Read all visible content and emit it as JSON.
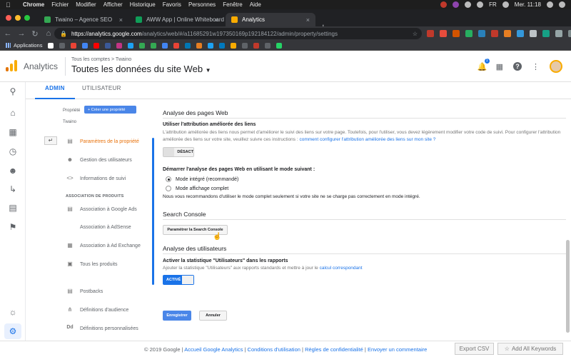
{
  "menubar": {
    "app": "Chrome",
    "items": [
      "Fichier",
      "Modifier",
      "Afficher",
      "Historique",
      "Favoris",
      "Personnes",
      "Fenêtre",
      "Aide"
    ],
    "clock": "Mer. 11:18",
    "lang": "FR"
  },
  "tabs": [
    {
      "title": "Twaino – Agence SEO",
      "icon_color": "#34a853"
    },
    {
      "title": "AWW App | Online Whiteboard",
      "icon_color": "#0f9d58"
    },
    {
      "title": "Analytics",
      "icon_color": "#f9ab00"
    }
  ],
  "toolbar": {
    "url_host": "https://analytics.google.com",
    "url_path": "/analytics/web/#/a11685291w197350169p192184122/admin/property/settings"
  },
  "bookmarks": {
    "apps_label": "Applications"
  },
  "header": {
    "product": "Analytics",
    "breadcrumb": "Tous les comptes > Twaino",
    "view_title": "Toutes les données du site Web",
    "notif_count": "1"
  },
  "admin_tabs": [
    "ADMIN",
    "UTILISATEUR"
  ],
  "property_menu": {
    "label": "Propriété",
    "create_btn": "+ Créer une propriété",
    "property_name": "Twaino",
    "items": [
      {
        "label": "Paramètres de la propriété",
        "icon": "settings-page-icon",
        "active": true
      },
      {
        "label": "Gestion des utilisateurs",
        "icon": "users-icon"
      },
      {
        "label": "Informations de suivi",
        "icon": "code-icon"
      }
    ],
    "section": "ASSOCIATION DE PRODUITS",
    "products": [
      {
        "label": "Association à Google Ads",
        "icon": "ads-icon"
      },
      {
        "label": "Association à AdSense",
        "icon": ""
      },
      {
        "label": "Association à Ad Exchange",
        "icon": "adexchange-icon"
      },
      {
        "label": "Tous les produits",
        "icon": "products-icon"
      }
    ],
    "others": [
      {
        "label": "Postbacks",
        "icon": "postbacks-icon"
      },
      {
        "label": "Définitions d'audience",
        "icon": "audience-icon"
      },
      {
        "label": "Définitions personnalisées",
        "icon": "dd-icon"
      }
    ]
  },
  "content": {
    "page_analysis_title": "Analyse des pages Web",
    "enhanced_link_title": "Utiliser l'attribution améliorée des liens",
    "enhanced_link_help": "L'attribution améliorée des liens nous permet d'améliorer le suivi des liens sur votre page. Toutefois, pour l'utiliser, vous devez légèrement modifier votre code de suivi. Pour configurer l'attribution améliorée des liens sur votre site, veuillez suivre ces instructions :",
    "enhanced_link_link": "comment configurer l'attribution améliorée des liens sur mon site ?",
    "toggle_off": "DÉSACT",
    "start_analysis_title": "Démarrer l'analyse des pages Web en utilisant le mode suivant :",
    "radio_integrated": "Mode intégré (recommandé)",
    "radio_full": "Mode affichage complet",
    "full_mode_note": "Nous vous recommandons d'utiliser le mode complet seulement si votre site ne se charge pas correctement en mode intégré.",
    "search_console_title": "Search Console",
    "search_console_btn": "Paramétrer la Search Console",
    "user_analysis_title": "Analyse des utilisateurs",
    "users_stat_title": "Activer la statistique \"Utilisateurs\" dans les rapports",
    "users_stat_help": "Ajouter la statistique \"Utilisateurs\" aux rapports standards et mettre à jour le",
    "users_stat_link": "calcul correspondant",
    "toggle_on": "ACTIVÉ",
    "save_btn": "Enregistrer",
    "cancel_btn": "Annuler"
  },
  "footer": {
    "copyright": "© 2019 Google",
    "links": [
      "Accueil Google Analytics",
      "Conditions d'utilisation",
      "Règles de confidentialité",
      "Envoyer un commentaire"
    ],
    "export_btn": "Export CSV",
    "add_btn": "Add All Keywords"
  },
  "colors": {
    "accent": "#1a73e8",
    "active_menu": "#e8710a",
    "save_button": "#4a86e8"
  }
}
